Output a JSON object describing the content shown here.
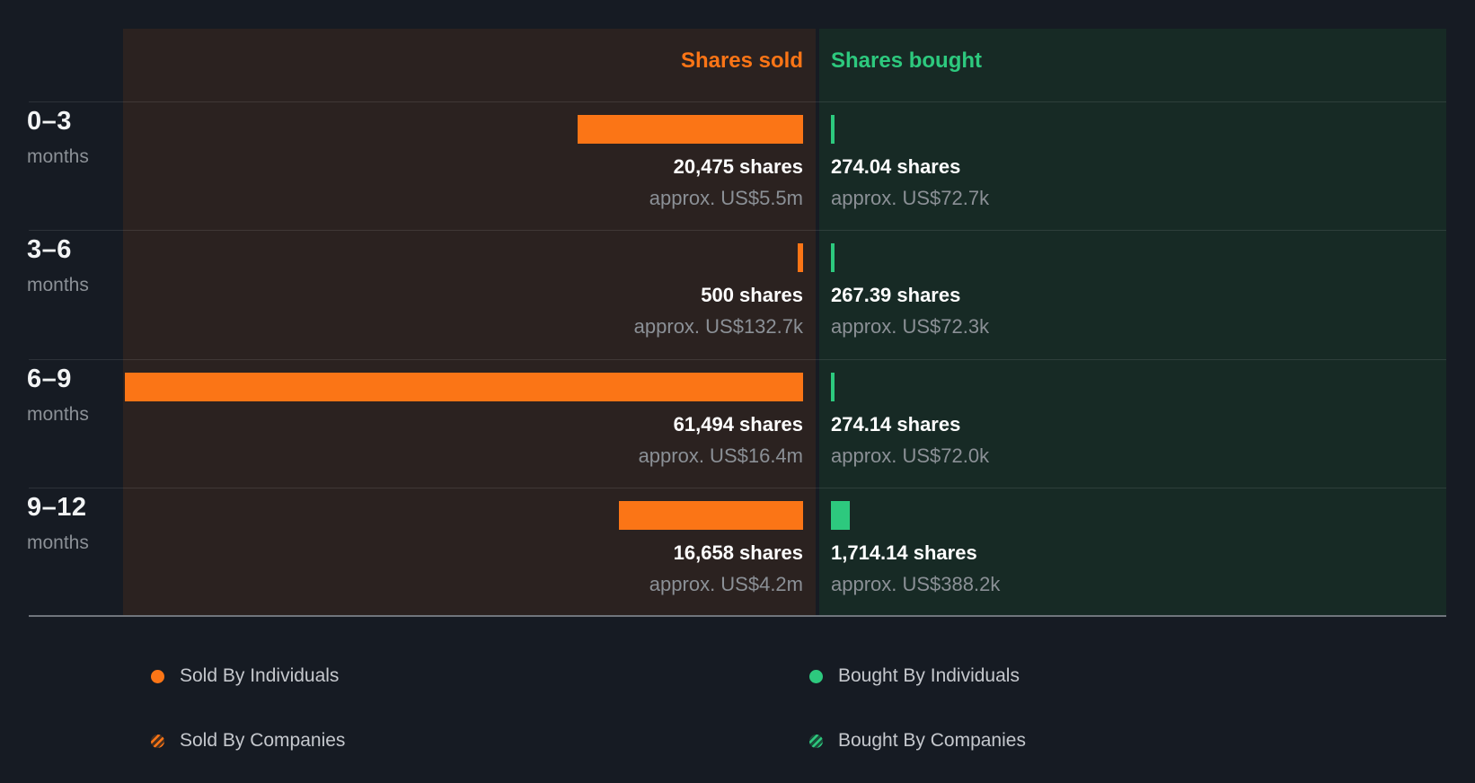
{
  "chart_data": {
    "type": "bar",
    "orientation": "horizontal-diverging",
    "columns": {
      "sold": "Shares sold",
      "bought": "Shares bought"
    },
    "colors": {
      "sold": "#fb7516",
      "bought": "#2dc97e",
      "sold_panel_bg": "#2b2220",
      "bought_panel_bg": "#172a25",
      "page_bg": "#161b23"
    },
    "xlabel": "",
    "ylabel": "",
    "axis_max_shares": 61494,
    "grid": "faint horizontal separators",
    "rows": [
      {
        "period": "0–3",
        "period_unit": "months",
        "sold_shares": 20475,
        "sold_shares_label": "20,475 shares",
        "sold_value_label": "approx. US$5.5m",
        "bought_shares": 274.04,
        "bought_shares_label": "274.04 shares",
        "bought_value_label": "approx. US$72.7k"
      },
      {
        "period": "3–6",
        "period_unit": "months",
        "sold_shares": 500,
        "sold_shares_label": "500 shares",
        "sold_value_label": "approx. US$132.7k",
        "bought_shares": 267.39,
        "bought_shares_label": "267.39 shares",
        "bought_value_label": "approx. US$72.3k"
      },
      {
        "period": "6–9",
        "period_unit": "months",
        "sold_shares": 61494,
        "sold_shares_label": "61,494 shares",
        "sold_value_label": "approx. US$16.4m",
        "bought_shares": 274.14,
        "bought_shares_label": "274.14 shares",
        "bought_value_label": "approx. US$72.0k"
      },
      {
        "period": "9–12",
        "period_unit": "months",
        "sold_shares": 16658,
        "sold_shares_label": "16,658 shares",
        "sold_value_label": "approx. US$4.2m",
        "bought_shares": 1714.14,
        "bought_shares_label": "1,714.14 shares",
        "bought_value_label": "approx. US$388.2k"
      }
    ]
  },
  "legend": {
    "items": [
      {
        "label": "Sold By Individuals",
        "swatch": "sold-solid"
      },
      {
        "label": "Sold By Companies",
        "swatch": "sold-striped"
      },
      {
        "label": "Bought By Individuals",
        "swatch": "bought-solid"
      },
      {
        "label": "Bought By Companies",
        "swatch": "bought-striped"
      }
    ]
  }
}
